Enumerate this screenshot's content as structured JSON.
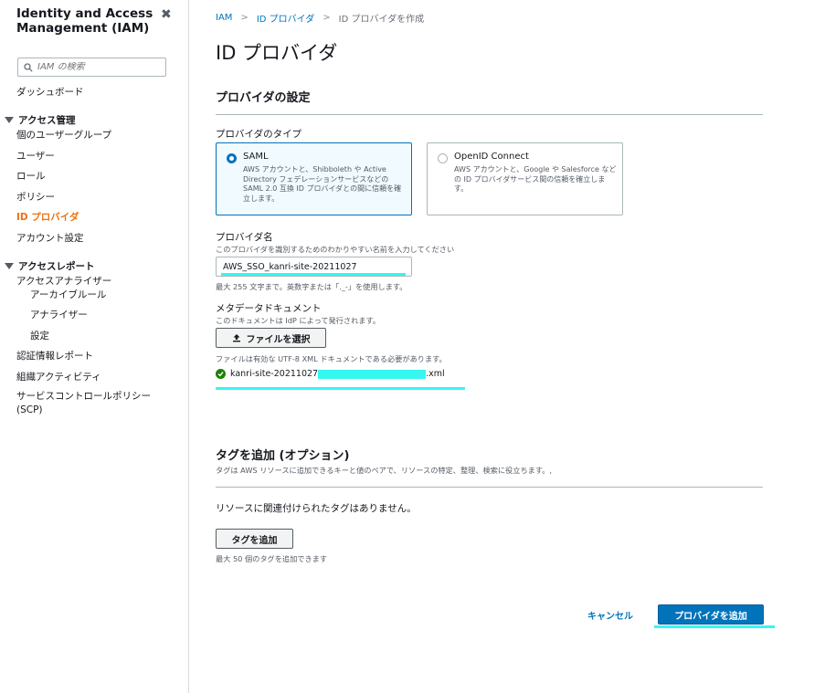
{
  "sidebar": {
    "title": "Identity and Access Management (IAM)",
    "search_placeholder": "IAM の検索",
    "dashboard": "ダッシュボード",
    "access_mgmt": {
      "label": "アクセス管理",
      "items": [
        "個のユーザーグループ",
        "ユーザー",
        "ロール",
        "ポリシー",
        "ID プロバイダ",
        "アカウント設定"
      ]
    },
    "access_reports": {
      "label": "アクセスレポート",
      "analyzer": "アクセスアナライザー",
      "analyzer_items": [
        "アーカイブルール",
        "アナライザー",
        "設定"
      ],
      "items": [
        "認証情報レポート",
        "組織アクティビティ",
        "サービスコントロールポリシー (SCP)"
      ]
    }
  },
  "breadcrumb": {
    "items": [
      "IAM",
      "ID プロバイダ"
    ],
    "current": "ID プロバイダを作成"
  },
  "page_title": "ID プロバイダ",
  "provider_settings": {
    "heading": "プロバイダの設定",
    "type_label": "プロバイダのタイプ",
    "types": [
      {
        "title": "SAML",
        "desc": "AWS アカウントと、Shibboleth や Active Directory フェデレーションサービスなどの SAML 2.0 互換 ID プロバイダとの間に信頼を確立します。",
        "selected": true
      },
      {
        "title": "OpenID Connect",
        "desc": "AWS アカウントと、Google や Salesforce などの ID プロバイダサービス間の信頼を確立します。",
        "selected": false
      }
    ],
    "name_label": "プロバイダ名",
    "name_desc": "このプロバイダを識別するためのわかりやすい名前を入力してください",
    "name_value": "AWS_SSO_kanri-site-20211027",
    "name_hint": "最大 255 文字まで。英数字または「._-」を使用します。",
    "metadata_label": "メタデータドキュメント",
    "metadata_desc": "このドキュメントは IdP によって発行されます。",
    "choose_file": "ファイルを選択",
    "file_hint": "ファイルは有効な UTF-8 XML ドキュメントである必要があります。",
    "file_name_prefix": "kanri-site-20211027",
    "file_name_suffix": ".xml"
  },
  "tags": {
    "heading": "タグを追加 (オプション)",
    "desc": "タグは AWS リソースに追加できるキーと値のペアで、リソースの特定、整理、検索に役立ちます。,",
    "empty": "リソースに関連付けられたタグはありません。",
    "add_button": "タグを追加",
    "limit_hint": "最大 50 個のタグを追加できます"
  },
  "footer": {
    "cancel": "キャンセル",
    "submit": "プロバイダを追加"
  },
  "colors": {
    "accent": "#0073bb",
    "active_nav": "#ec7211",
    "highlight": "#36f7ef",
    "success": "#1d8102"
  }
}
